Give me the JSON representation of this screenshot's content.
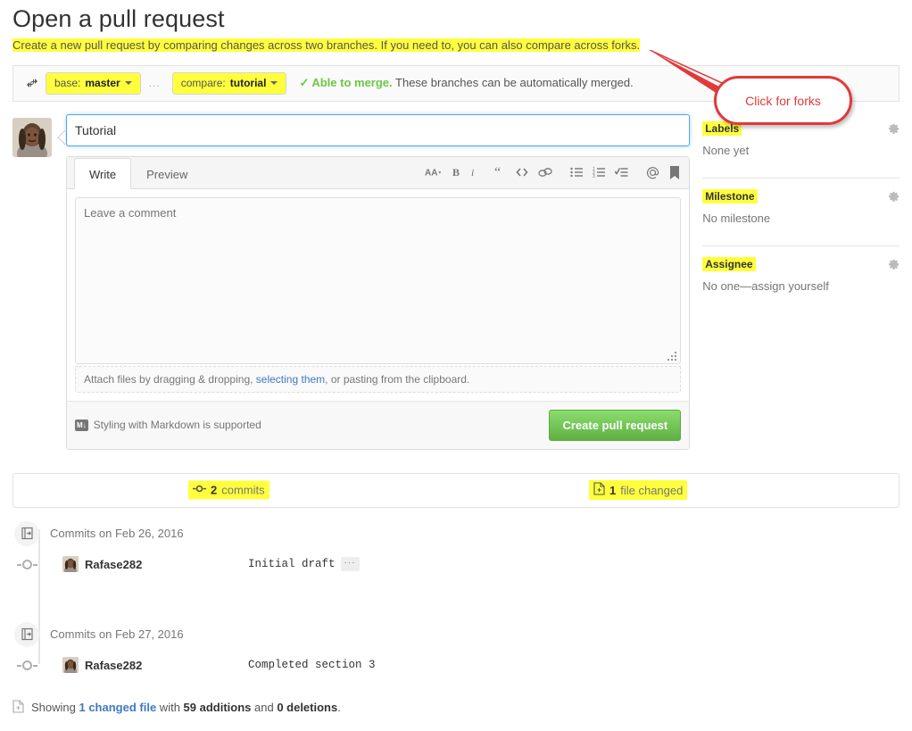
{
  "header": {
    "title": "Open a pull request",
    "subtitle": "Create a new pull request by comparing changes across two branches. If you need to, you can also compare across forks."
  },
  "compare_bar": {
    "icon": "git-compare-icon",
    "base_prefix": "base:",
    "base_branch": "master",
    "separator": "...",
    "compare_prefix": "compare:",
    "compare_branch": "tutorial",
    "check_icon": "check-icon",
    "merge_status_strong": "Able to merge.",
    "merge_status_text": "These branches can be automatically merged."
  },
  "callout": {
    "text": "Click for forks",
    "color": "#e03a3a"
  },
  "form": {
    "avatar_name": "user-avatar",
    "title_value": "Tutorial",
    "title_placeholder": "Title",
    "tabs": [
      {
        "label": "Write",
        "active": true
      },
      {
        "label": "Preview",
        "active": false
      }
    ],
    "toolbar": [
      {
        "name": "text-size-icon",
        "label": "AA"
      },
      {
        "name": "bold-icon",
        "label": "B"
      },
      {
        "name": "italic-icon",
        "label": "i"
      },
      {
        "name": "quote-icon",
        "label": "“"
      },
      {
        "name": "code-icon",
        "label": "<>"
      },
      {
        "name": "link-icon",
        "label": "link"
      },
      {
        "name": "unordered-list-icon",
        "label": "list"
      },
      {
        "name": "ordered-list-icon",
        "label": "1."
      },
      {
        "name": "task-list-icon",
        "label": "task"
      },
      {
        "name": "mention-icon",
        "label": "@"
      },
      {
        "name": "saved-replies-icon",
        "label": "bookmark"
      }
    ],
    "comment_placeholder": "Leave a comment",
    "comment_value": "",
    "attach_text_before": "Attach files by dragging & dropping, ",
    "attach_link": "selecting them",
    "attach_text_after": ", or pasting from the clipboard.",
    "markdown_badge": "M↓",
    "markdown_note": "Styling with Markdown is supported",
    "submit_label": "Create pull request",
    "submit_color": "#60b044"
  },
  "sidebar": {
    "sections": [
      {
        "title": "Labels",
        "value": "None yet",
        "gear": "gear-icon"
      },
      {
        "title": "Milestone",
        "value": "No milestone",
        "gear": "gear-icon"
      },
      {
        "title": "Assignee",
        "value": "No one—assign yourself",
        "gear": "gear-icon"
      }
    ]
  },
  "tabs_box": {
    "commits_icon": "git-commit-icon",
    "commits_count": "2",
    "commits_label": "commits",
    "files_icon": "file-diff-icon",
    "files_count": "1",
    "files_label": "file changed"
  },
  "commit_groups": [
    {
      "badge_icon": "git-commit-group-icon",
      "header": "Commits on Feb 26, 2016",
      "commits": [
        {
          "user": "Rafase282",
          "message": "Initial draft",
          "more": "···",
          "has_more": true
        }
      ]
    },
    {
      "badge_icon": "git-commit-group-icon",
      "header": "Commits on Feb 27, 2016",
      "commits": [
        {
          "user": "Rafase282",
          "message": "Completed section 3",
          "more": "",
          "has_more": false
        }
      ]
    }
  ],
  "footer": {
    "icon": "file-diff-icon",
    "showing": "Showing ",
    "changed_file_link": "1 changed file",
    "with_text": " with ",
    "additions": "59 additions",
    "and_text": " and ",
    "deletions": "0 deletions",
    "period": "."
  },
  "highlight_color": "#ffff3d"
}
